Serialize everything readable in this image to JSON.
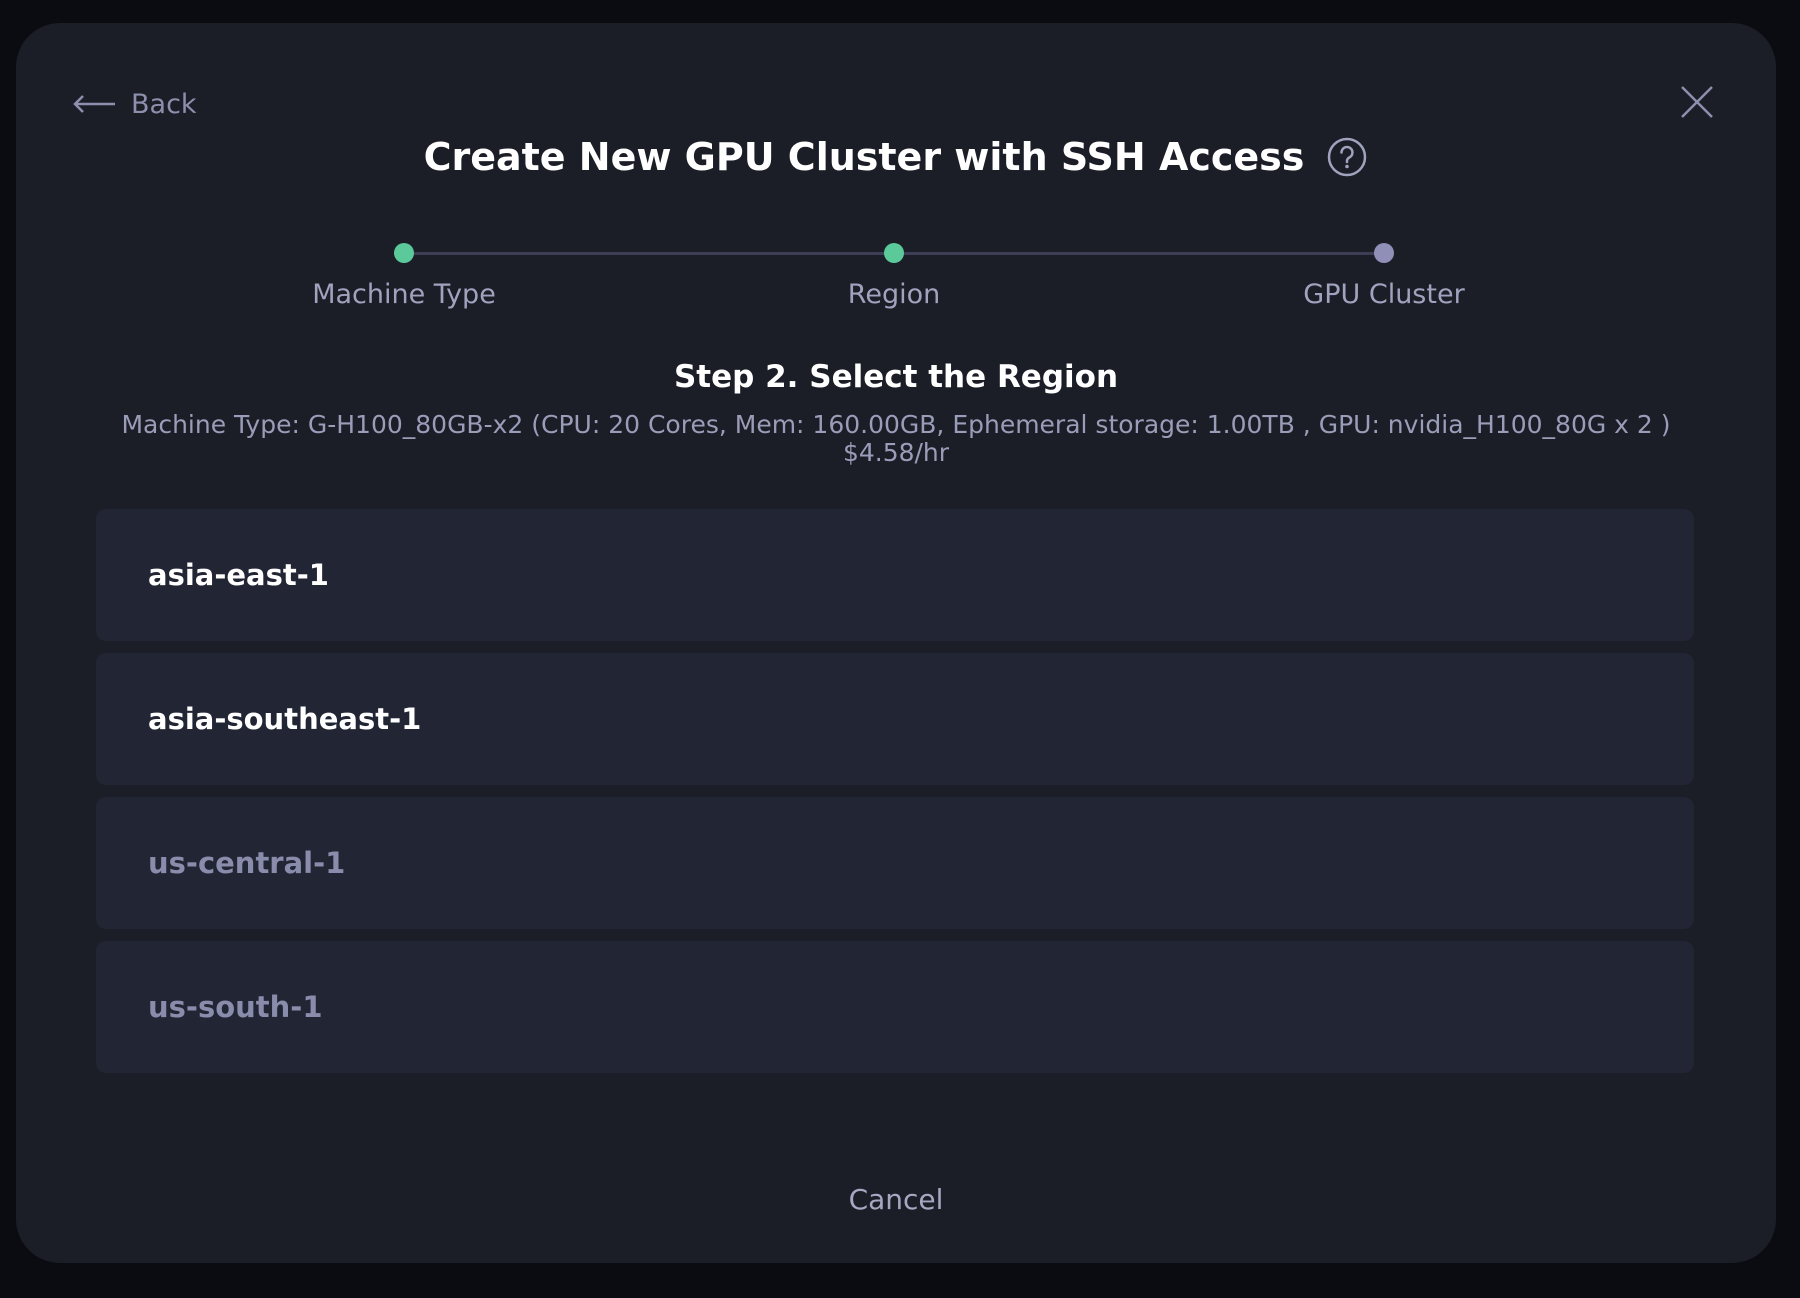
{
  "header": {
    "back_label": "Back",
    "title": "Create New GPU Cluster with SSH Access",
    "help_icon": "question-circle-icon",
    "close_icon": "close-icon"
  },
  "stepper": {
    "steps": [
      {
        "label": "Machine Type",
        "state": "complete"
      },
      {
        "label": "Region",
        "state": "current"
      },
      {
        "label": "GPU Cluster",
        "state": "pending"
      }
    ],
    "colors": {
      "complete": "#5cc99b",
      "current": "#5cc99b",
      "pending": "#8f8fb8"
    }
  },
  "main": {
    "step_heading": "Step 2. Select the Region",
    "machine_info": "Machine Type: G-H100_80GB-x2 (CPU: 20 Cores, Mem: 160.00GB, Ephemeral storage: 1.00TB , GPU: nvidia_H100_80G x 2 )",
    "price": "$4.58/hr",
    "regions": [
      {
        "name": "asia-east-1",
        "available": true
      },
      {
        "name": "asia-southeast-1",
        "available": true
      },
      {
        "name": "us-central-1",
        "available": false
      },
      {
        "name": "us-south-1",
        "available": false
      }
    ]
  },
  "footer": {
    "cancel_label": "Cancel"
  }
}
